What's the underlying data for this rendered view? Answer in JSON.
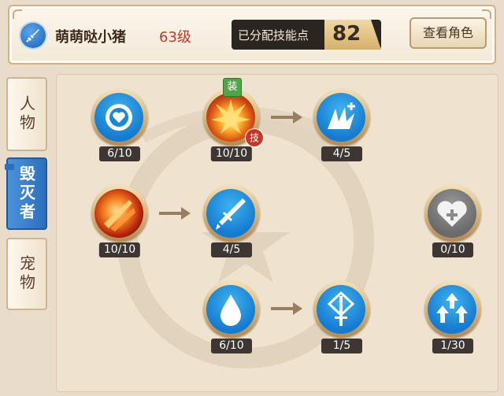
{
  "header": {
    "class_icon": "sword-icon",
    "player_name": "萌萌哒小猪",
    "player_level": "63级",
    "points_label": "已分配技能点",
    "points_value": "82",
    "view_role_button": "查看角色"
  },
  "tabs": [
    {
      "label": "人物",
      "active": false
    },
    {
      "label": "毁灭者",
      "active": true
    },
    {
      "label": "宠物",
      "active": false
    }
  ],
  "skills": [
    {
      "id": "heart",
      "icon": "heart-icon",
      "level": "6/10"
    },
    {
      "id": "explosion",
      "icon": "explosion-icon",
      "level": "10/10",
      "badge_top": "装",
      "badge_corner": "技"
    },
    {
      "id": "claw-plus",
      "icon": "claw-plus-icon",
      "level": "4/5"
    },
    {
      "id": "flame-slash",
      "icon": "flame-slash-icon",
      "level": "10/10"
    },
    {
      "id": "broken-sword",
      "icon": "broken-sword-icon",
      "level": "4/5"
    },
    {
      "id": "heart-plus",
      "icon": "heart-plus-icon",
      "level": "0/10"
    },
    {
      "id": "drop",
      "icon": "water-drop-icon",
      "level": "6/10"
    },
    {
      "id": "sword-shield",
      "icon": "sword-shield-icon",
      "level": "1/5"
    },
    {
      "id": "arrows-up",
      "icon": "arrows-up-icon",
      "level": "1/30"
    }
  ],
  "colors": {
    "accent_blue": "#2b6fbd",
    "level_red": "#c0392b",
    "skill_disc_blue": "#157bd0"
  }
}
